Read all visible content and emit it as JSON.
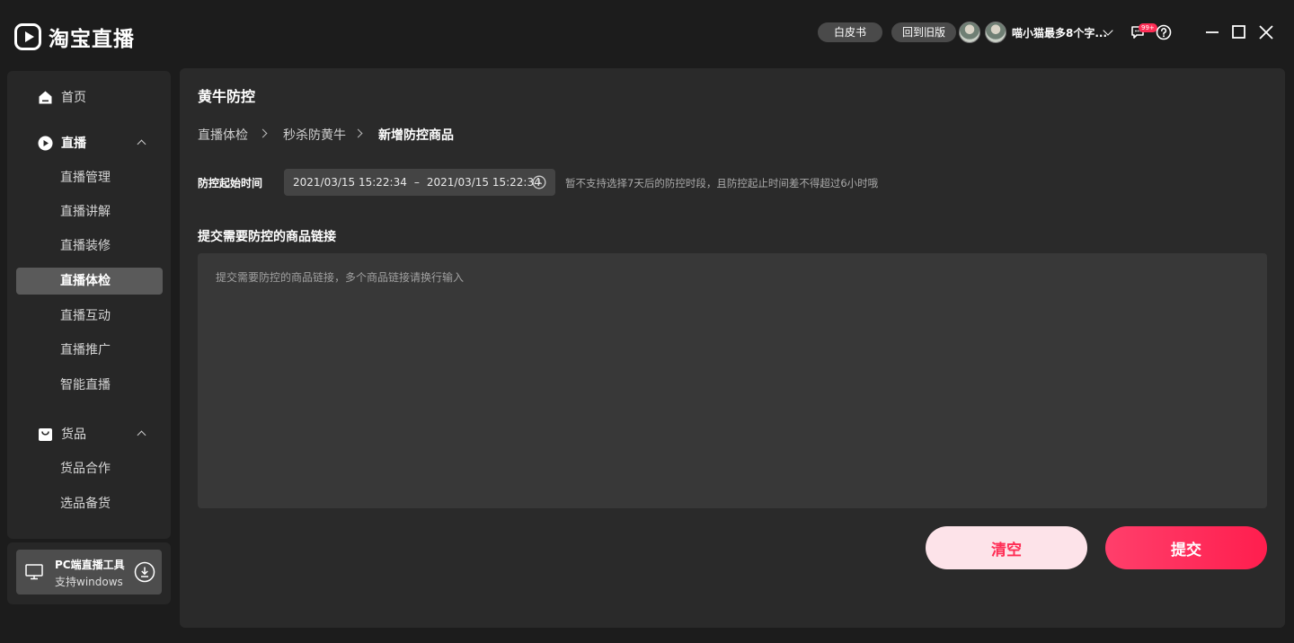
{
  "app": {
    "brand": "淘宝直播"
  },
  "header": {
    "whitepaper_label": "白皮书",
    "old_version_label": "回到旧版",
    "username": "喵小猫最多8个字...",
    "message_badge": "99+"
  },
  "sidebar": {
    "home": "首页",
    "live": {
      "label": "直播",
      "items": [
        "直播管理",
        "直播讲解",
        "直播装修",
        "直播体检",
        "直播互动",
        "直播推广",
        "智能直播"
      ],
      "active_index": 3
    },
    "goods": {
      "label": "货品",
      "items": [
        "货品合作",
        "选品备货"
      ]
    },
    "promo": {
      "title": "PC端直播工具",
      "subtitle": "支持windows"
    }
  },
  "main": {
    "title": "黄牛防控",
    "breadcrumb": [
      "直播体检",
      "秒杀防黄牛",
      "新增防控商品"
    ],
    "time_label": "防控起始时间",
    "start_time": "2021/03/15 15:22:34",
    "range_sep": "–",
    "end_time": "2021/03/15 15:22:34",
    "time_hint": "暂不支持选择7天后的防控时段，且防控起止时间差不得超过6小时哦",
    "links_label": "提交需要防控的商品链接",
    "links_placeholder": "提交需要防控的商品链接，多个商品链接请换行输入",
    "clear_label": "清空",
    "submit_label": "提交"
  }
}
